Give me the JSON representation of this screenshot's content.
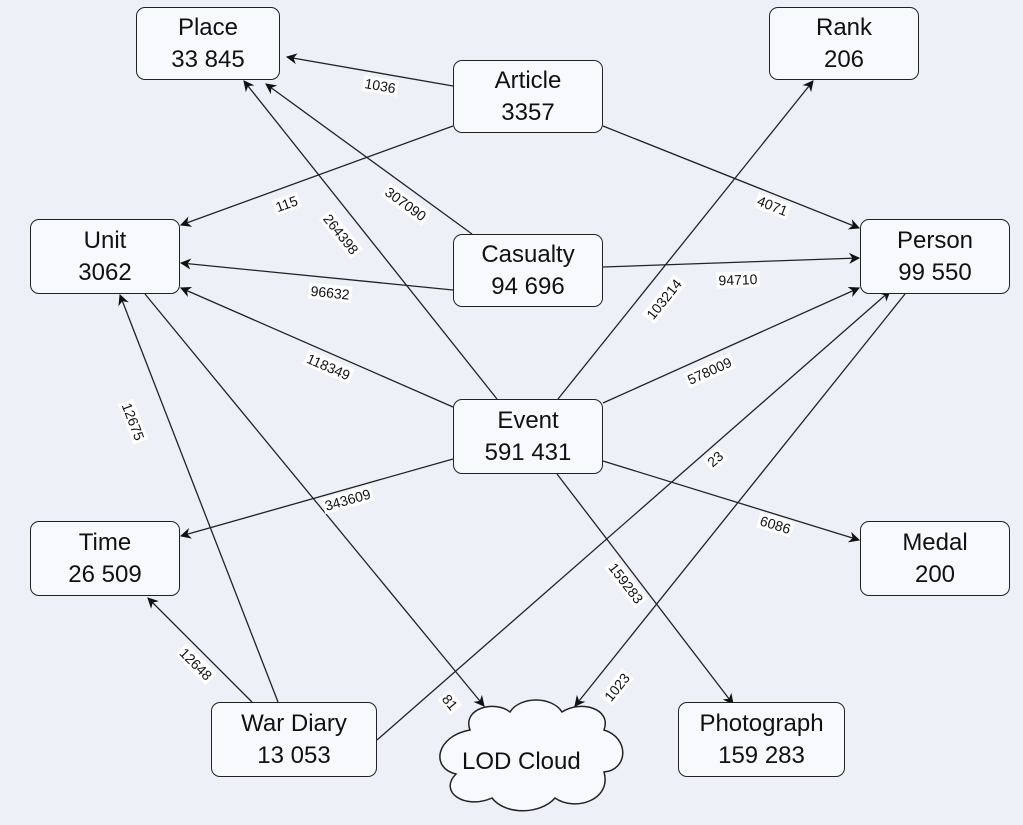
{
  "colors": {
    "background": "#edf1f7",
    "node_fill": "#f7f9fd",
    "stroke": "#222222"
  },
  "nodes": {
    "place": {
      "name": "Place",
      "count": "33 845"
    },
    "rank": {
      "name": "Rank",
      "count": "206"
    },
    "article": {
      "name": "Article",
      "count": "3357"
    },
    "unit": {
      "name": "Unit",
      "count": "3062"
    },
    "casualty": {
      "name": "Casualty",
      "count": "94 696"
    },
    "person": {
      "name": "Person",
      "count": "99 550"
    },
    "event": {
      "name": "Event",
      "count": "591 431"
    },
    "time": {
      "name": "Time",
      "count": "26 509"
    },
    "medal": {
      "name": "Medal",
      "count": "200"
    },
    "wardiary": {
      "name": "War Diary",
      "count": "13 053"
    },
    "photograph": {
      "name": "Photograph",
      "count": "159 283"
    },
    "lod": {
      "name": "LOD Cloud",
      "shape": "cloud"
    }
  },
  "edges": [
    {
      "from": "article",
      "to": "place",
      "label": "1036"
    },
    {
      "from": "article",
      "to": "unit",
      "label": "115"
    },
    {
      "from": "article",
      "to": "person",
      "label": "4071"
    },
    {
      "from": "casualty",
      "to": "place",
      "label": "307090"
    },
    {
      "from": "event",
      "to": "place",
      "label": "264398"
    },
    {
      "from": "casualty",
      "to": "unit",
      "label": "96632"
    },
    {
      "from": "casualty",
      "to": "person",
      "label": "94710"
    },
    {
      "from": "event",
      "to": "unit",
      "label": "118349"
    },
    {
      "from": "event",
      "to": "rank",
      "label": "103214"
    },
    {
      "from": "event",
      "to": "person",
      "label": "578009"
    },
    {
      "from": "event",
      "to": "time",
      "label": "343609"
    },
    {
      "from": "event",
      "to": "medal",
      "label": "6086"
    },
    {
      "from": "event",
      "to": "photograph",
      "label": "159283"
    },
    {
      "from": "unit",
      "to": "lod",
      "label": "81"
    },
    {
      "from": "wardiary",
      "to": "unit",
      "label": "12675"
    },
    {
      "from": "wardiary",
      "to": "time",
      "label": "12648"
    },
    {
      "from": "wardiary",
      "to": "person",
      "label": "23"
    },
    {
      "from": "person",
      "to": "lod",
      "label": "1023"
    }
  ]
}
